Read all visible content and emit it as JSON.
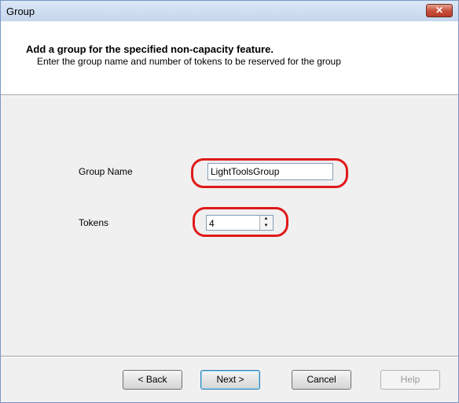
{
  "window": {
    "title": "Group",
    "close_glyph": "✕"
  },
  "header": {
    "title": "Add a group for the specified non-capacity feature.",
    "subtitle": "Enter the group name and number of tokens to be reserved for the group"
  },
  "form": {
    "group_name_label": "Group Name",
    "group_name_value": "LightToolsGroup",
    "tokens_label": "Tokens",
    "tokens_value": "4"
  },
  "icons": {
    "spin_up": "▴",
    "spin_down": "▾"
  },
  "buttons": {
    "back": "< Back",
    "next": "Next >",
    "cancel": "Cancel",
    "help": "Help"
  },
  "colors": {
    "highlight": "#e01a1a",
    "titlebar": "#c4d6ee",
    "close": "#c8513d"
  }
}
